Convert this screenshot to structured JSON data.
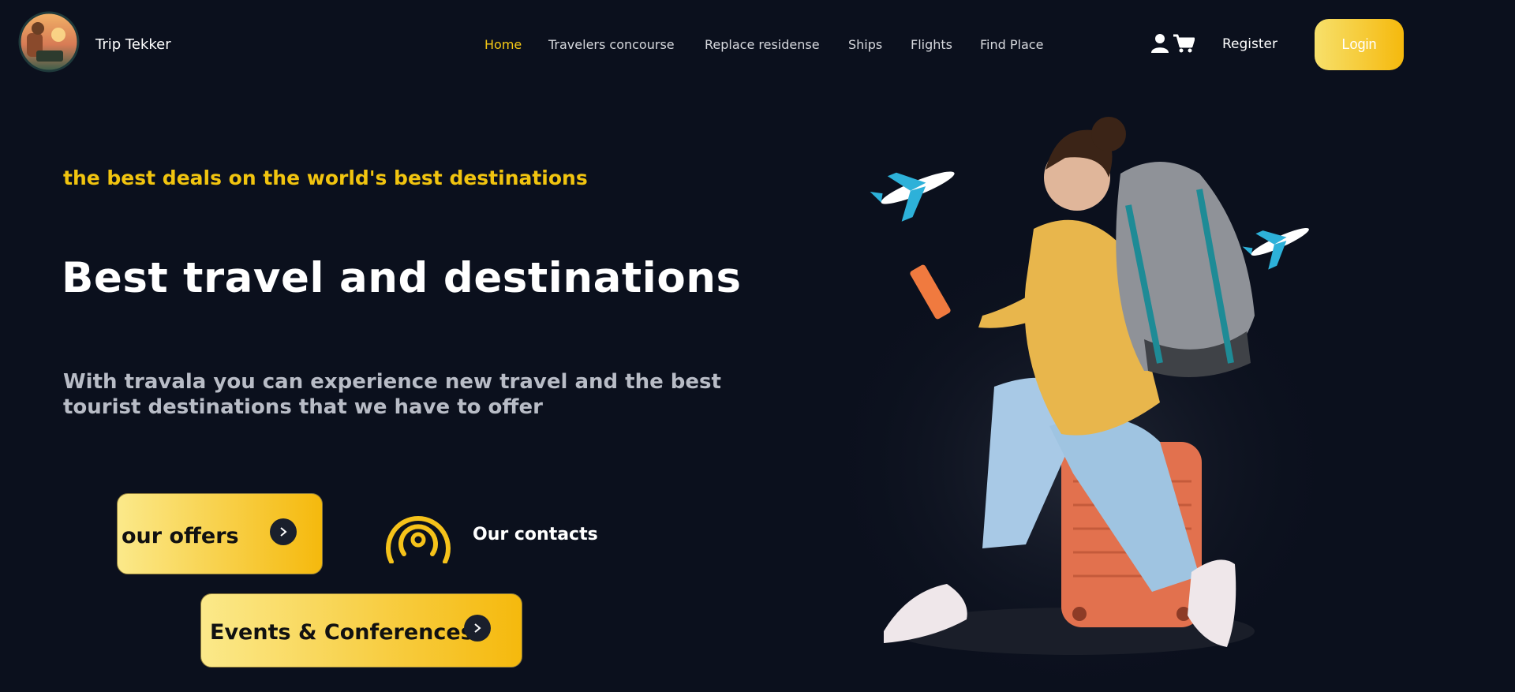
{
  "brand": {
    "name": "Trip Tekker"
  },
  "nav": {
    "items": [
      {
        "label": "Home",
        "active": true
      },
      {
        "label": "Travelers concourse"
      },
      {
        "label": "Replace residense"
      },
      {
        "label": "Ships"
      },
      {
        "label": "Flights"
      },
      {
        "label": "Find Place"
      }
    ],
    "register_label": "Register",
    "login_label": "Login"
  },
  "icons": [
    "user-icon",
    "cart-icon",
    "chevron-right-icon",
    "broadcast-icon"
  ],
  "hero": {
    "tagline": "the best deals on the world's best destinations",
    "headline": "Best travel and destinations",
    "description": "With travala you can experience new travel and the best tourist destinations that we have to offer"
  },
  "actions": {
    "offers_label": "our offers",
    "events_label": "Events & Conferences",
    "contacts_label": "Our contacts"
  },
  "colors": {
    "background": "#0b101d",
    "accent": "#f6c915",
    "button_gradient_start": "#fbe98a",
    "button_gradient_end": "#f5b90d"
  }
}
